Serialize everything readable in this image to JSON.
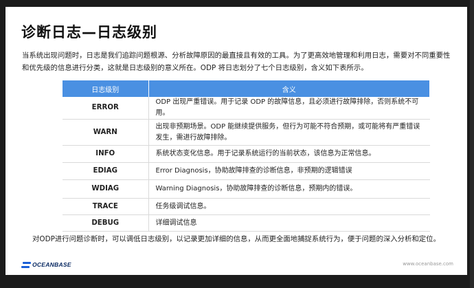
{
  "slide": {
    "title": "诊断日志—日志级别",
    "intro": "当系统出现问题时，日志是我们追踪问题根源、分析故障原因的最直接且有效的工具。为了更高效地管理和利用日志，需要对不同重要性和优先级的信息进行分类，这就是日志级别的意义所在。ODP 将日志划分了七个日志级别，含义如下表所示。",
    "table": {
      "headers": [
        "日志级别",
        "含义"
      ],
      "rows": [
        {
          "level": "ERROR",
          "desc": "ODP 出现严重错误。用于记录 ODP 的故障信息，且必须进行故障排除，否则系统不可用。"
        },
        {
          "level": "WARN",
          "desc": "出现非预期场景。ODP 能继续提供服务，但行为可能不符合预期，或可能将有严重错误发生，需进行故障排除。"
        },
        {
          "level": "INFO",
          "desc": "系统状态变化信息。用于记录系统运行的当前状态，该信息为正常信息。"
        },
        {
          "level": "EDIAG",
          "desc": "Error Diagnosis，协助故障排查的诊断信息，非预期的逻辑错误"
        },
        {
          "level": "WDIAG",
          "desc": "Warning Diagnosis，协助故障排查的诊断信息，预期内的错误。"
        },
        {
          "level": "TRACE",
          "desc": "任务级调试信息。"
        },
        {
          "level": "DEBUG",
          "desc": "详细调试信息"
        }
      ]
    },
    "footnote": "对ODP进行问题诊断时，可以调低日志级别，以记录更加详细的信息，从而更全面地捕捉系统行为，便于问题的深入分析和定位。",
    "logo_text": "OCEANBASE",
    "url": "www.oceanbase.com"
  },
  "colors": {
    "header_bg": "#4a90e2",
    "logo_blue": "#1a5fd6",
    "logo_text": "#0b2b63"
  }
}
